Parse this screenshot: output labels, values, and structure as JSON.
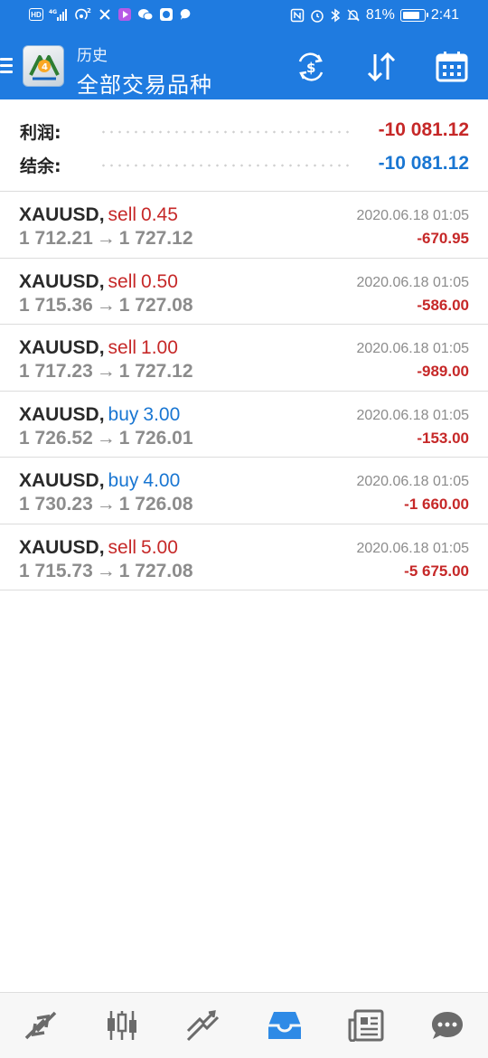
{
  "status_bar": {
    "left_icons": [
      "hd-icon",
      "signal-4g-icon",
      "hotspot-icon",
      "music-icon",
      "video-app-icon",
      "wechat-icon",
      "app-icon",
      "message-icon"
    ],
    "right_icons": [
      "nfc-icon",
      "alarm-icon",
      "bluetooth-icon",
      "mute-icon"
    ],
    "battery": "81%",
    "battery_level": 0.81,
    "time": "2:41"
  },
  "app_bar": {
    "subtitle": "历史",
    "title": "全部交易品种",
    "actions": [
      "currency-exchange-icon",
      "sort-icon",
      "calendar-icon"
    ]
  },
  "summary": {
    "profit_label": "利润:",
    "profit_value": "-10 081.12",
    "balance_label": "结余:",
    "balance_value": "-10 081.12"
  },
  "deals": [
    {
      "symbol": "XAUUSD",
      "type": "sell",
      "volume": "0.45",
      "open_price": "1 712.21",
      "close_price": "1 727.12",
      "time": "2020.06.18 01:05",
      "profit": "-670.95"
    },
    {
      "symbol": "XAUUSD",
      "type": "sell",
      "volume": "0.50",
      "open_price": "1 715.36",
      "close_price": "1 727.08",
      "time": "2020.06.18 01:05",
      "profit": "-586.00"
    },
    {
      "symbol": "XAUUSD",
      "type": "sell",
      "volume": "1.00",
      "open_price": "1 717.23",
      "close_price": "1 727.12",
      "time": "2020.06.18 01:05",
      "profit": "-989.00"
    },
    {
      "symbol": "XAUUSD",
      "type": "buy",
      "volume": "3.00",
      "open_price": "1 726.52",
      "close_price": "1 726.01",
      "time": "2020.06.18 01:05",
      "profit": "-153.00"
    },
    {
      "symbol": "XAUUSD",
      "type": "buy",
      "volume": "4.00",
      "open_price": "1 730.23",
      "close_price": "1 726.08",
      "time": "2020.06.18 01:05",
      "profit": "-1 660.00"
    },
    {
      "symbol": "XAUUSD",
      "type": "sell",
      "volume": "5.00",
      "open_price": "1 715.73",
      "close_price": "1 727.08",
      "time": "2020.06.18 01:05",
      "profit": "-5 675.00"
    }
  ],
  "bottom_nav": [
    "quotes-icon",
    "chart-icon",
    "trade-icon",
    "history-icon",
    "news-icon",
    "chat-icon"
  ],
  "active_nav": "history-icon",
  "colors": {
    "primary": "#1f7be0",
    "sell": "#c62828",
    "buy": "#1976d2",
    "loss": "#c62828",
    "balance": "#1976d2",
    "muted": "#8c8c8c",
    "nav_icon": "#6b6b6b",
    "nav_active": "#2e8ae6"
  }
}
